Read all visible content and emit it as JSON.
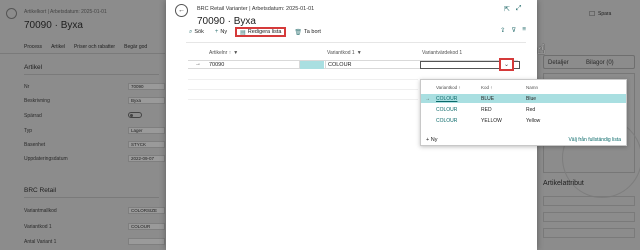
{
  "background": {
    "breadcrumb": "Artikelkort | Arbetsdatum: 2025-01-01",
    "title": "70090 · Byxa",
    "menu": [
      "Process",
      "Artikel",
      "Priser och rabatter",
      "Begär god"
    ],
    "section_artikel": "Artikel",
    "fields": [
      {
        "label": "Nr",
        "value": "70090"
      },
      {
        "label": "Beskrivning",
        "value": "Byxa"
      },
      {
        "label": "Spärrad",
        "value": ""
      },
      {
        "label": "Typ",
        "value": "Lager"
      },
      {
        "label": "Basenhet",
        "value": "STYCK"
      },
      {
        "label": "Uppdateringsdatum",
        "value": "2022-09-07"
      }
    ],
    "section_brc": "BRC Retail",
    "brc_fields": [
      {
        "label": "Variantmallkod",
        "value": "COLORSIZE"
      },
      {
        "label": "Variantkod 1",
        "value": "COLOUR"
      },
      {
        "label": "Antal Variant 1",
        "value": ""
      }
    ],
    "right": {
      "save": "Spara",
      "tab_details": "Detaljer",
      "tab_attachments": "Bilagor (0)",
      "attributes": "Artikelattribut"
    }
  },
  "modal": {
    "breadcrumb": "BRC Retail Varianter | Arbetsdatum: 2025-01-01",
    "title": "70090 · Byxa",
    "toolbar": {
      "search": "Sök",
      "new": "Ny",
      "edit_list": "Redigera lista",
      "delete": "Ta bort"
    },
    "columns": {
      "article": "Artikelnr ↑",
      "variant_code": "Variantkod 1",
      "variant_value": "Variantvärdekod 1"
    },
    "row": {
      "article": "70090",
      "variant_code": "COLOUR",
      "variant_value": ""
    }
  },
  "lookup": {
    "headers": {
      "variant_code": "Variantkod ↑",
      "code": "Kod ↑",
      "name": "Namn"
    },
    "rows": [
      {
        "variant_code": "COLOUR",
        "code": "BLUE",
        "name": "Blue",
        "selected": true
      },
      {
        "variant_code": "COLOUR",
        "code": "RED",
        "name": "Red",
        "selected": false
      },
      {
        "variant_code": "COLOUR",
        "code": "YELLOW",
        "name": "Yellow",
        "selected": false
      }
    ],
    "new": "Ny",
    "full_list": "Välj från fullständig lista"
  },
  "colors": {
    "accent_teal": "#0b6a6a",
    "selection": "#a9dfe1",
    "highlight_red": "#d53a3a"
  }
}
